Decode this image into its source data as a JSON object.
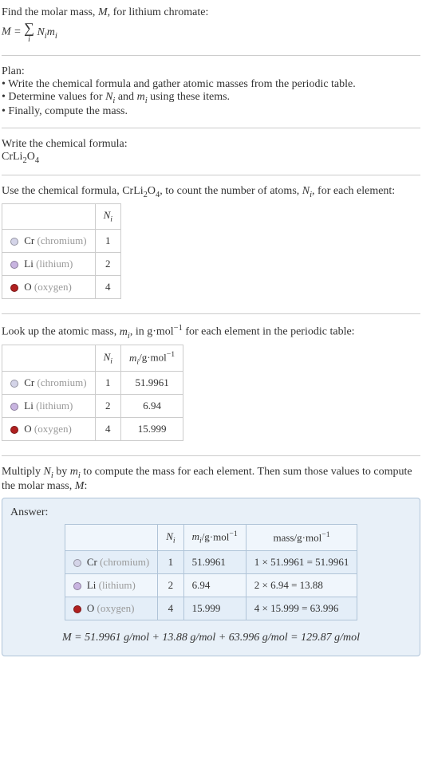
{
  "intro": {
    "line1": "Find the molar mass, ",
    "line1_var": "M",
    "line1_cont": ", for lithium chromate:",
    "eq_lhs": "M = ",
    "eq_rhs": "N",
    "eq_rhs2": "m"
  },
  "plan": {
    "heading": "Plan:",
    "b1": "• Write the chemical formula and gather atomic masses from the periodic table.",
    "b2_a": "• Determine values for ",
    "b2_b": " and ",
    "b2_c": " using these items.",
    "b3": "• Finally, compute the mass."
  },
  "step1": {
    "heading": "Write the chemical formula:",
    "formula": "CrLi",
    "sub1": "2",
    "formula2": "O",
    "sub2": "4"
  },
  "step2": {
    "line_a": "Use the chemical formula, CrLi",
    "line_b": "O",
    "line_c": ", to count the number of atoms, ",
    "line_d": ", for each element:"
  },
  "table1": {
    "header_ni": "N",
    "rows": [
      {
        "el": "Cr",
        "name": "(chromium)",
        "ni": "1",
        "dot": "dot-cr"
      },
      {
        "el": "Li",
        "name": "(lithium)",
        "ni": "2",
        "dot": "dot-li"
      },
      {
        "el": "O",
        "name": "(oxygen)",
        "ni": "4",
        "dot": "dot-o"
      }
    ]
  },
  "step3": {
    "line_a": "Look up the atomic mass, ",
    "line_b": ", in g·mol",
    "line_c": " for each element in the periodic table:"
  },
  "table2": {
    "header_mi": "m",
    "header_unit": "/g·mol",
    "rows": [
      {
        "el": "Cr",
        "name": "(chromium)",
        "ni": "1",
        "mi": "51.9961",
        "dot": "dot-cr"
      },
      {
        "el": "Li",
        "name": "(lithium)",
        "ni": "2",
        "mi": "6.94",
        "dot": "dot-li"
      },
      {
        "el": "O",
        "name": "(oxygen)",
        "ni": "4",
        "mi": "15.999",
        "dot": "dot-o"
      }
    ]
  },
  "step4": {
    "line_a": "Multiply ",
    "line_b": " by ",
    "line_c": " to compute the mass for each element. Then sum those values to compute the molar mass, ",
    "line_d": ":"
  },
  "answer": {
    "label": "Answer:",
    "header_mass": "mass/g·mol",
    "rows": [
      {
        "el": "Cr",
        "name": "(chromium)",
        "ni": "1",
        "mi": "51.9961",
        "mass": "1 × 51.9961 = 51.9961",
        "dot": "dot-cr"
      },
      {
        "el": "Li",
        "name": "(lithium)",
        "ni": "2",
        "mi": "6.94",
        "mass": "2 × 6.94 = 13.88",
        "dot": "dot-li"
      },
      {
        "el": "O",
        "name": "(oxygen)",
        "ni": "4",
        "mi": "15.999",
        "mass": "4 × 15.999 = 63.996",
        "dot": "dot-o"
      }
    ],
    "result": "M = 51.9961 g/mol + 13.88 g/mol + 63.996 g/mol = 129.87 g/mol"
  }
}
